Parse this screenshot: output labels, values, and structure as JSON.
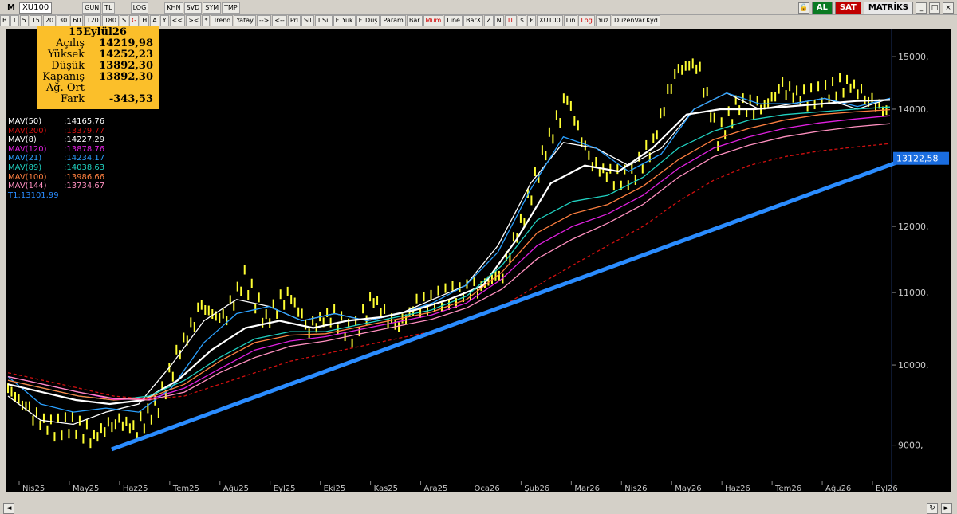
{
  "window": {
    "symbol_code": "XU100",
    "menu_letter": "M"
  },
  "toolbar": {
    "row1": [
      "GUN",
      "TL",
      "LOG",
      "KHN",
      "SVD",
      "SYM",
      "TMP"
    ],
    "row2": [
      "B",
      "1",
      "5",
      "15",
      "20",
      "30",
      "60",
      "120",
      "180",
      "S",
      "G",
      "H",
      "A",
      "Y",
      "<<",
      "><",
      "*",
      "Trend",
      "Yatay",
      "-->",
      "<--",
      "Prl",
      "Sil",
      "T.Sil",
      "F. Yük",
      "F. Düş",
      "Param",
      "Bar",
      "Mum",
      "Line",
      "BarX",
      "Z",
      "N",
      "TL",
      "$",
      "€",
      "XU100",
      "Lin",
      "Log",
      "Yüz",
      "DüzenVar.Kyd"
    ],
    "red_items": [
      "G",
      "Mum",
      "TL",
      "Log"
    ]
  },
  "right_buttons": {
    "al": "AL",
    "sat": "SAT",
    "matrix": "MATRİKS"
  },
  "info_box": {
    "date": "15Eylül26",
    "rows": [
      {
        "label": "Açılış",
        "value": "14219,98"
      },
      {
        "label": "Yüksek",
        "value": "14252,23"
      },
      {
        "label": "Düşük",
        "value": "13892,30"
      },
      {
        "label": "Kapanış",
        "value": "13892,30"
      },
      {
        "label": "Ağ. Ort",
        "value": ""
      },
      {
        "label": "Fark",
        "value": "-343,53"
      }
    ]
  },
  "legend": [
    {
      "name": "MAV(50)",
      "value": ":14165,76",
      "color": "#ffffff"
    },
    {
      "name": "MAV(200)",
      "value": ":13379,77",
      "color": "#d01010"
    },
    {
      "name": "MAV(8)",
      "value": ":14227,29",
      "color": "#ffffff"
    },
    {
      "name": "MAV(120)",
      "value": ":13878,76",
      "color": "#e020e0"
    },
    {
      "name": "MAV(21)",
      "value": ":14234,17",
      "color": "#2aa0ff"
    },
    {
      "name": "MAV(89)",
      "value": ":14038,63",
      "color": "#20d0c0"
    },
    {
      "name": "MAV(100)",
      "value": ":13986,66",
      "color": "#ff8040"
    },
    {
      "name": "MAV(144)",
      "value": ":13734,67",
      "color": "#ff90c0"
    },
    {
      "name": "T1",
      "value": ":13101,99",
      "color": "#2a8cff"
    }
  ],
  "chart_data": {
    "type": "line",
    "x_labels": [
      "Nis25",
      "May25",
      "Haz25",
      "Tem25",
      "Ağu25",
      "Eyl25",
      "Eki25",
      "Kas25",
      "Ara25",
      "Oca26",
      "Şub26",
      "Mar26",
      "Nis26",
      "May26",
      "Haz26",
      "Tem26",
      "Ağu26",
      "Eyl26"
    ],
    "y_ticks": [
      "15000,",
      "14000,",
      "12000,",
      "11000,",
      "10000,",
      "9000,"
    ],
    "y_tick_values": [
      15000,
      14000,
      12000,
      11000,
      10000,
      9000
    ],
    "y_log_scale": true,
    "ylim": [
      8600,
      15400
    ],
    "last_price_label": "13122,58",
    "price_series": [
      9700,
      9400,
      9200,
      9250,
      9100,
      9300,
      9200,
      9500,
      10200,
      10800,
      10600,
      11200,
      10600,
      11000,
      10500,
      10700,
      10400,
      10900,
      10500,
      10800,
      10900,
      11000,
      11100,
      11300,
      12200,
      13300,
      14200,
      13100,
      12800,
      12800,
      13400,
      14700,
      14900,
      13500,
      14100,
      14000,
      14400,
      14200,
      14300,
      14500,
      14200,
      13900
    ],
    "ma_series": [
      {
        "name": "MAV(8)",
        "color": "#ffffff",
        "values": [
          9600,
          9300,
          9250,
          9400,
          9500,
          10000,
          10600,
          10900,
          10800,
          10600,
          10700,
          10600,
          10700,
          10900,
          11100,
          11700,
          12700,
          13400,
          13300,
          13000,
          13300,
          14000,
          14300,
          14000,
          14100,
          14200,
          14000,
          14200
        ]
      },
      {
        "name": "MAV(21)",
        "color": "#2aa0ff",
        "values": [
          9850,
          9500,
          9400,
          9450,
          9400,
          9700,
          10300,
          10700,
          10800,
          10600,
          10700,
          10600,
          10700,
          10850,
          11100,
          11600,
          12600,
          13500,
          13300,
          12900,
          13200,
          14000,
          14300,
          14100,
          14100,
          14200,
          14050,
          14200
        ]
      },
      {
        "name": "MAV(50)",
        "color": "#ffffff",
        "values": [
          9750,
          9650,
          9550,
          9500,
          9550,
          9800,
          10200,
          10500,
          10600,
          10500,
          10600,
          10650,
          10750,
          10900,
          11100,
          11800,
          12700,
          13000,
          12900,
          13300,
          13900,
          14000,
          14000,
          14050,
          14100,
          14150,
          14170
        ]
      },
      {
        "name": "MAV(89)",
        "color": "#20d0c0",
        "values": [
          9800,
          9700,
          9600,
          9550,
          9600,
          9800,
          10100,
          10350,
          10450,
          10450,
          10550,
          10650,
          10750,
          10950,
          11400,
          12100,
          12400,
          12500,
          12800,
          13300,
          13600,
          13800,
          13900,
          13950,
          14000,
          14040
        ]
      },
      {
        "name": "MAV(100)",
        "color": "#ff8040",
        "values": [
          9800,
          9700,
          9600,
          9550,
          9580,
          9750,
          10050,
          10300,
          10400,
          10420,
          10520,
          10620,
          10720,
          10900,
          11300,
          11900,
          12200,
          12350,
          12650,
          13100,
          13450,
          13650,
          13800,
          13900,
          13950,
          13990
        ]
      },
      {
        "name": "MAV(120)",
        "color": "#e020e0",
        "values": [
          9850,
          9750,
          9650,
          9560,
          9560,
          9700,
          9950,
          10200,
          10320,
          10380,
          10480,
          10580,
          10680,
          10850,
          11200,
          11700,
          12000,
          12200,
          12500,
          12950,
          13300,
          13500,
          13650,
          13750,
          13820,
          13880
        ]
      },
      {
        "name": "MAV(144)",
        "color": "#ff90c0",
        "values": [
          9850,
          9750,
          9650,
          9570,
          9550,
          9650,
          9900,
          10100,
          10250,
          10320,
          10420,
          10520,
          10620,
          10780,
          11050,
          11500,
          11800,
          12050,
          12350,
          12800,
          13150,
          13350,
          13500,
          13600,
          13680,
          13735
        ]
      },
      {
        "name": "MAV(200)",
        "color": "#d01010",
        "values": [
          9900,
          9800,
          9700,
          9600,
          9560,
          9600,
          9750,
          9900,
          10050,
          10150,
          10250,
          10350,
          10450,
          10600,
          10800,
          11100,
          11400,
          11700,
          12000,
          12400,
          12750,
          13000,
          13150,
          13250,
          13320,
          13380
        ]
      }
    ],
    "trendline": {
      "name": "T1",
      "from": 8950,
      "to": 13101.99
    }
  }
}
